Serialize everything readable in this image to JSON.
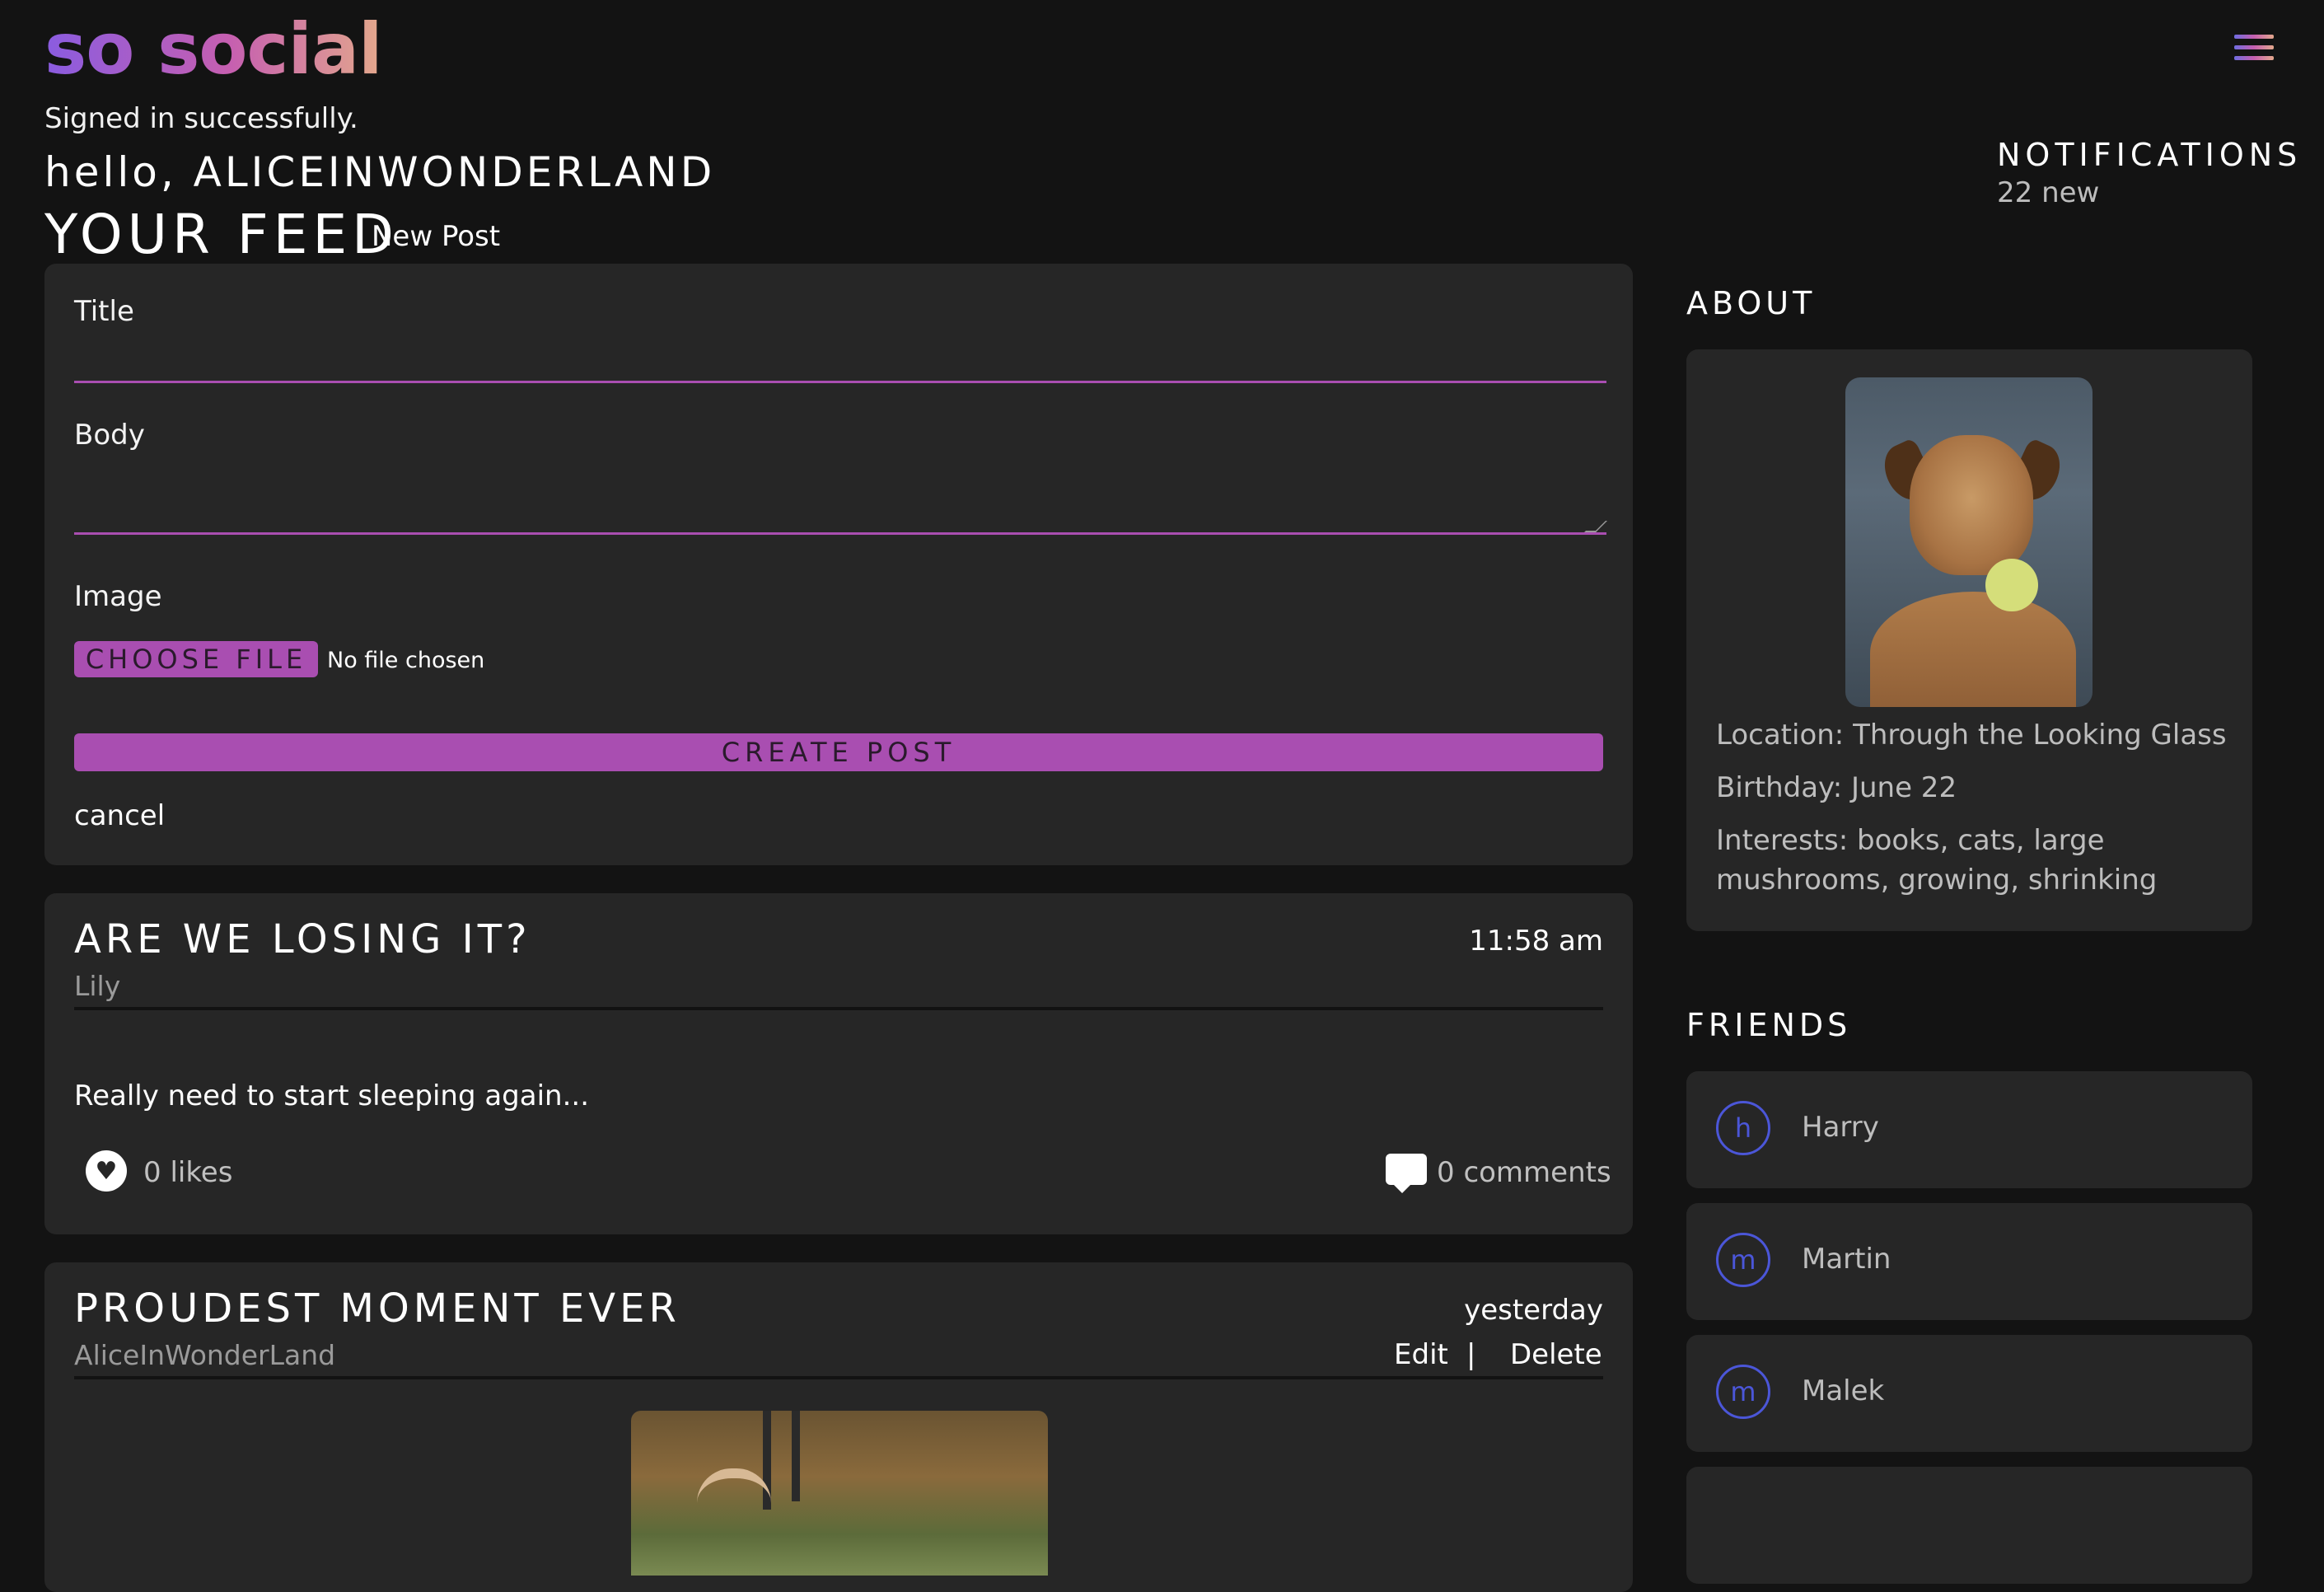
{
  "header": {
    "logo": "so social"
  },
  "flash": "Signed in successfully.",
  "greeting": "hello, ALICEINWONDERLAND",
  "feed": {
    "title": "YOUR FEED",
    "new_post": "New Post"
  },
  "notifications": {
    "title": "NOTIFICATIONS",
    "count": "22 new"
  },
  "form": {
    "title_label": "Title",
    "body_label": "Body",
    "image_label": "Image",
    "choose_file": "CHOOSE FILE",
    "no_file": "No file chosen",
    "create": "CREATE POST",
    "cancel": "cancel",
    "title_value": "",
    "body_value": ""
  },
  "posts": [
    {
      "title": "ARE WE LOSING IT?",
      "author": "Lily",
      "time": "11:58 am",
      "body": "Really need to start sleeping again...",
      "likes": "0 likes",
      "comments": "0 comments"
    },
    {
      "title": "PROUDEST MOMENT EVER",
      "author": "AliceInWonderLand",
      "time": "yesterday",
      "edit": "Edit",
      "separator": "|",
      "delete": "Delete"
    }
  ],
  "about": {
    "title": "ABOUT",
    "location": "Location: Through the Looking Glass",
    "birthday": "Birthday: June 22",
    "interests": "Interests: books, cats, large mushrooms, growing, shrinking"
  },
  "friends": {
    "title": "FRIENDS",
    "items": [
      {
        "initial": "h",
        "name": "Harry"
      },
      {
        "initial": "m",
        "name": "Martin"
      },
      {
        "initial": "m",
        "name": "Malek"
      }
    ]
  },
  "colors": {
    "accent": "#a94eb1",
    "friend_ring": "#4b56d8",
    "background": "#131313",
    "card": "#262626"
  },
  "icons": {
    "menu": "hamburger-menu-icon",
    "like": "heart-icon",
    "comment": "comment-bubble-icon"
  }
}
